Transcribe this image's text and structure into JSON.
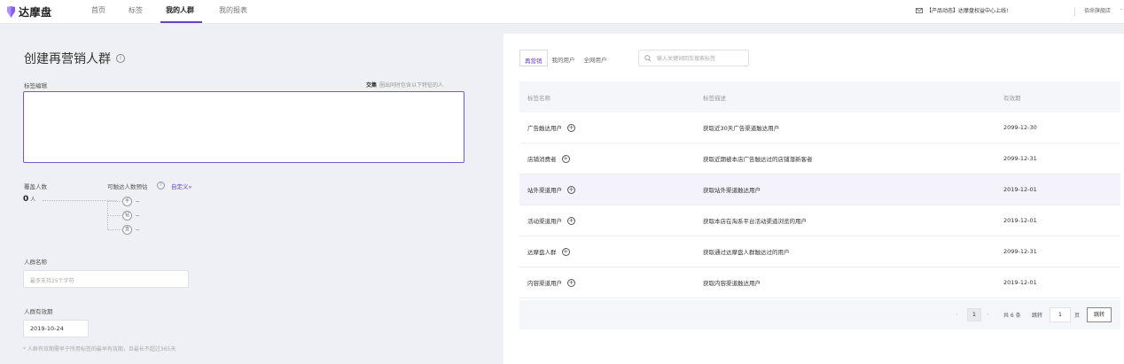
{
  "header": {
    "logo_text": "达摩盘",
    "nav": [
      "首页",
      "标签",
      "我的人群",
      "我的报表"
    ],
    "notice": "【产品动态】达摩盘权益中心上线!",
    "store": "佰命旗舰店"
  },
  "form": {
    "title": "创建再营销人群",
    "tag_edit_label": "标签编辑",
    "intersect_label": "交集",
    "intersect_desc": "圈出同时包含以下特征的人",
    "cover_label": "覆盖人数",
    "reach_label": "可触达人数预估",
    "custom_link": "自定义»",
    "cover_value": "0",
    "cover_unit": "人",
    "reach_channels": [
      {
        "icon": "手",
        "value": "--"
      },
      {
        "icon": "钻",
        "value": "--"
      },
      {
        "icon": "直",
        "value": "--"
      }
    ],
    "name_label": "人群名称",
    "name_placeholder": "最多支持25个字符",
    "expiry_label": "人群有效期",
    "expiry_value": "2019-10-24",
    "hint": "* 人群有效期需早于所用标签的最早有效期，且最长不超过365天"
  },
  "tags_panel": {
    "tabs": [
      "再营销",
      "我的用户",
      "全网用户"
    ],
    "search_placeholder": "输入关键词回车搜索标签",
    "columns": [
      "标签名称",
      "标签描述",
      "有效期"
    ],
    "rows": [
      {
        "name": "广告触达用户",
        "desc": "获取近30天广告渠道触达用户",
        "date": "2099-12-30"
      },
      {
        "name": "店铺消费者",
        "desc": "获取近期被本店广告触达过的店铺潜新客者",
        "date": "2099-12-31"
      },
      {
        "name": "站外渠道用户",
        "desc": "获取站外渠道触达用户",
        "date": "2019-12-01"
      },
      {
        "name": "活动渠道用户",
        "desc": "获取本店在淘系平台活动渠道浏览的用户",
        "date": "2019-12-01"
      },
      {
        "name": "达摩盘人群",
        "desc": "获取通过达摩盘人群触达过的用户",
        "date": "2099-12-31"
      },
      {
        "name": "内容渠道用户",
        "desc": "获取内容渠道触达用户",
        "date": "2019-12-01"
      }
    ],
    "pagination": {
      "current": "1",
      "total": "共 6 条",
      "goto": "跳转",
      "goto_value": "1",
      "page_unit": "页",
      "jump": "跳转"
    }
  },
  "colors": {
    "accent": "#6b3fc6"
  },
  "icons": {
    "notice": "envelope-icon",
    "search": "search-icon",
    "add": "plus-circle-icon"
  }
}
